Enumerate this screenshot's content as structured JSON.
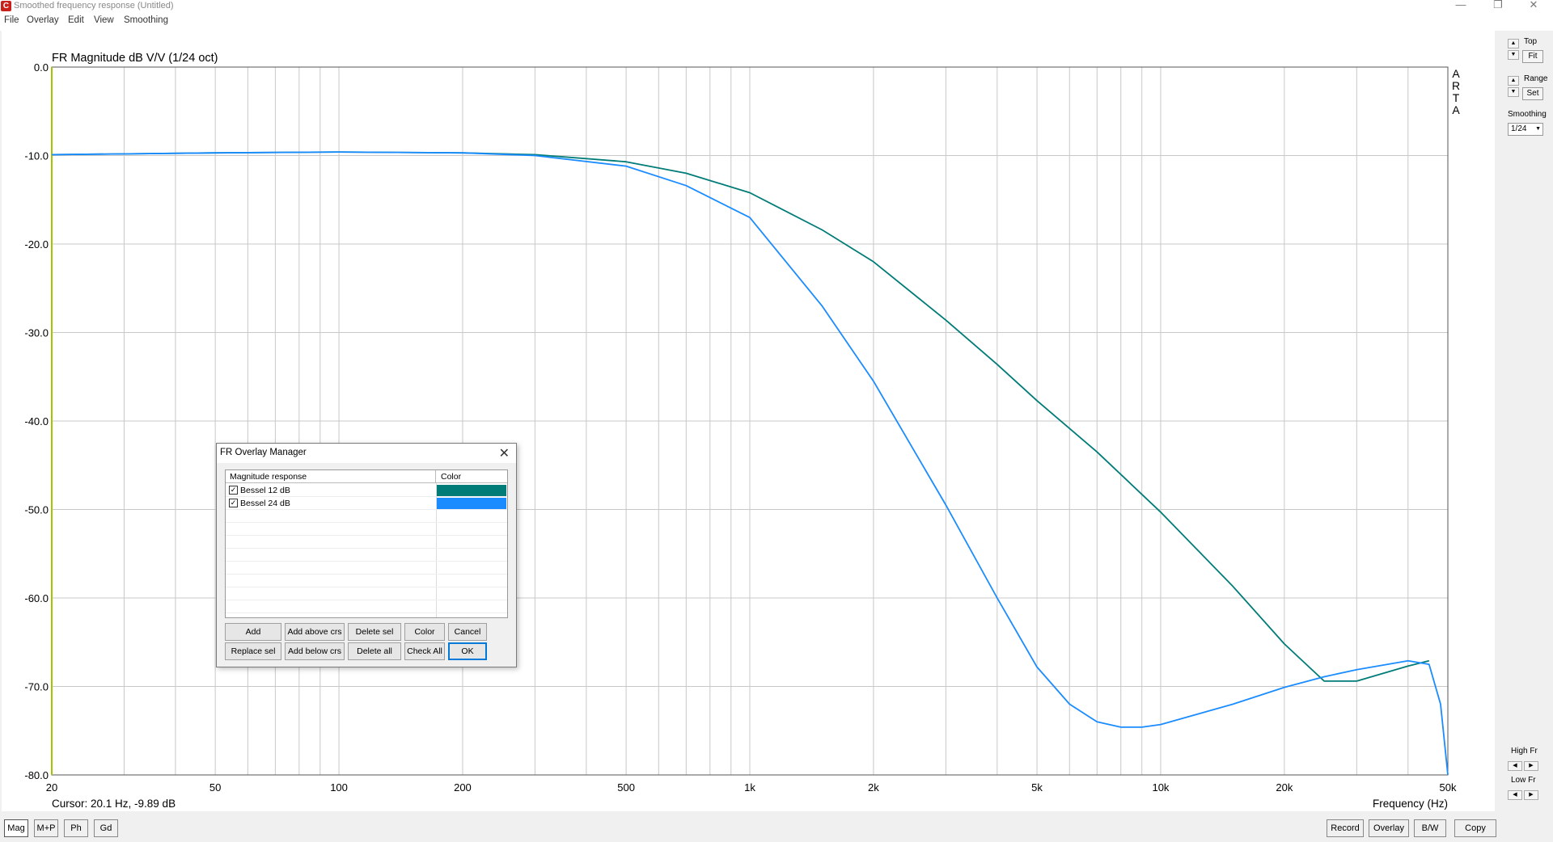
{
  "window": {
    "title": "Smoothed frequency response (Untitled)",
    "icon_label": "C"
  },
  "menu": [
    "File",
    "Overlay",
    "Edit",
    "View",
    "Smoothing"
  ],
  "plot": {
    "title": "FR Magnitude dB V/V (1/24 oct)",
    "side_label": [
      "A",
      "R",
      "T",
      "A"
    ],
    "cursor_text": "Cursor: 20.1 Hz, -9.89 dB",
    "xlabel": "Frequency (Hz)"
  },
  "chart_data": {
    "type": "line",
    "title": "FR Magnitude dB V/V (1/24 oct)",
    "xlabel": "Frequency (Hz)",
    "ylabel": "",
    "xscale": "log",
    "xlim": [
      20,
      50000
    ],
    "ylim": [
      -80,
      0
    ],
    "grid": true,
    "x_ticks": [
      {
        "v": 20,
        "label": "20"
      },
      {
        "v": 50,
        "label": "50"
      },
      {
        "v": 100,
        "label": "100"
      },
      {
        "v": 200,
        "label": "200"
      },
      {
        "v": 500,
        "label": "500"
      },
      {
        "v": 1000,
        "label": "1k"
      },
      {
        "v": 2000,
        "label": "2k"
      },
      {
        "v": 5000,
        "label": "5k"
      },
      {
        "v": 10000,
        "label": "10k"
      },
      {
        "v": 20000,
        "label": "20k"
      },
      {
        "v": 50000,
        "label": "50k"
      }
    ],
    "y_ticks": [
      {
        "v": 0,
        "label": "0.0"
      },
      {
        "v": -10,
        "label": "-10.0"
      },
      {
        "v": -20,
        "label": "-20.0"
      },
      {
        "v": -30,
        "label": "-30.0"
      },
      {
        "v": -40,
        "label": "-40.0"
      },
      {
        "v": -50,
        "label": "-50.0"
      },
      {
        "v": -60,
        "label": "-60.0"
      },
      {
        "v": -70,
        "label": "-70.0"
      },
      {
        "v": -80,
        "label": "-80.0"
      }
    ],
    "series": [
      {
        "name": "Bessel 12 dB",
        "color": "#007c78",
        "x": [
          20,
          50,
          100,
          200,
          300,
          500,
          700,
          1000,
          1500,
          2000,
          3000,
          4000,
          5000,
          7000,
          10000,
          15000,
          20000,
          25000,
          30000,
          40000,
          45000
        ],
        "y": [
          -9.9,
          -9.7,
          -9.6,
          -9.7,
          -9.9,
          -10.7,
          -12.0,
          -14.2,
          -18.4,
          -22.0,
          -28.6,
          -33.6,
          -37.7,
          -43.5,
          -50.3,
          -58.7,
          -65.2,
          -69.4,
          -69.4,
          -67.7,
          -67.1
        ]
      },
      {
        "name": "Bessel 24 dB",
        "color": "#1a8cff",
        "x": [
          20,
          50,
          100,
          200,
          300,
          500,
          700,
          1000,
          1500,
          2000,
          3000,
          4000,
          5000,
          6000,
          7000,
          8000,
          9000,
          10000,
          15000,
          20000,
          25000,
          30000,
          40000,
          45000,
          48000,
          50000
        ],
        "y": [
          -9.9,
          -9.7,
          -9.6,
          -9.7,
          -10.0,
          -11.2,
          -13.4,
          -17.0,
          -27.0,
          -35.5,
          -49.5,
          -60.0,
          -67.8,
          -72.0,
          -74.0,
          -74.6,
          -74.6,
          -74.3,
          -72.0,
          -70.1,
          -68.9,
          -68.1,
          -67.1,
          -67.5,
          -72.0,
          -80.0
        ]
      }
    ]
  },
  "right_panel": {
    "top_label": "Top",
    "fit_label": "Fit",
    "range_label": "Range",
    "set_label": "Set",
    "smoothing_label": "Smoothing",
    "smoothing_value": "1/24",
    "highfr_label": "High Fr",
    "lowfr_label": "Low Fr"
  },
  "bottom_buttons": {
    "left": [
      "Mag",
      "M+P",
      "Ph",
      "Gd"
    ],
    "right": [
      "Record",
      "Overlay",
      "B/W",
      "Copy"
    ]
  },
  "dialog": {
    "title": "FR Overlay Manager",
    "col_response": "Magnitude response",
    "col_color": "Color",
    "rows": [
      {
        "label": "Bessel 12 dB",
        "checked": true,
        "color": "#007c78"
      },
      {
        "label": "Bessel 24 dB",
        "checked": true,
        "color": "#1a8cff"
      }
    ],
    "buttons_row1": [
      "Add",
      "Add above crs",
      "Delete sel",
      "Color",
      "Cancel"
    ],
    "buttons_row2": [
      "Replace sel",
      "Add below crs",
      "Delete all",
      "Check All",
      "OK"
    ]
  }
}
